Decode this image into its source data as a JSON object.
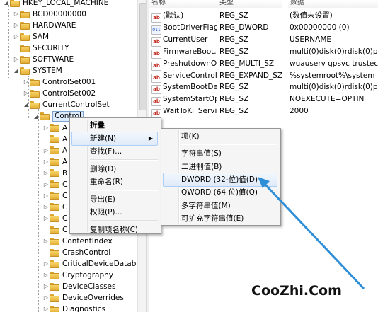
{
  "tree": {
    "items": [
      {
        "label": "HKEY_LOCAL_MACHINE",
        "exp": "◢"
      },
      {
        "label": "BCD00000000",
        "exp": "▷"
      },
      {
        "label": "HARDWARE",
        "exp": "▷"
      },
      {
        "label": "SAM",
        "exp": "▷"
      },
      {
        "label": "SECURITY",
        "exp": ""
      },
      {
        "label": "SOFTWARE",
        "exp": "▷"
      },
      {
        "label": "SYSTEM",
        "exp": "◢"
      },
      {
        "label": "ControlSet001",
        "exp": "▷"
      },
      {
        "label": "ControlSet002",
        "exp": "▷"
      },
      {
        "label": "CurrentControlSet",
        "exp": "◢"
      },
      {
        "label": "Control",
        "exp": "◢"
      },
      {
        "label": "A",
        "exp": "▷"
      },
      {
        "label": "A",
        "exp": ""
      },
      {
        "label": "A",
        "exp": "▷"
      },
      {
        "label": "A",
        "exp": "▷"
      },
      {
        "label": "B",
        "exp": "▷"
      },
      {
        "label": "C",
        "exp": "▷"
      },
      {
        "label": "C",
        "exp": "▷"
      },
      {
        "label": "C",
        "exp": "▷"
      },
      {
        "label": "C",
        "exp": "▷"
      },
      {
        "label": "C",
        "exp": ""
      },
      {
        "label": "ContentIndex",
        "exp": "▷"
      },
      {
        "label": "CrashControl",
        "exp": ""
      },
      {
        "label": "CriticalDeviceDatabas",
        "exp": "▷"
      },
      {
        "label": "Cryptography",
        "exp": "▷"
      },
      {
        "label": "DeviceClasses",
        "exp": "▷"
      },
      {
        "label": "DeviceOverrides",
        "exp": "▷"
      },
      {
        "label": "Diagnostics",
        "exp": "▷"
      }
    ]
  },
  "columns": {
    "name": "名称",
    "type": "类型",
    "data": "数据"
  },
  "values": [
    {
      "icon": "ab",
      "icon_kind": "string-value-icon",
      "name": "(默认)",
      "type": "REG_SZ",
      "data": "(数值未设置)"
    },
    {
      "icon": "011",
      "icon_kind": "binary-value-icon",
      "name": "BootDriverFlags",
      "type": "REG_DWORD",
      "data": "0x00000000 (0)"
    },
    {
      "icon": "ab",
      "icon_kind": "string-value-icon",
      "name": "CurrentUser",
      "type": "REG_SZ",
      "data": "USERNAME"
    },
    {
      "icon": "ab",
      "icon_kind": "string-value-icon",
      "name": "FirmwareBoot...",
      "type": "REG_SZ",
      "data": "multi(0)disk(0)rdisk(0)p"
    },
    {
      "icon": "ab",
      "icon_kind": "string-value-icon",
      "name": "PreshutdownO...",
      "type": "REG_MULTI_SZ",
      "data": "wuauserv gpsvc trustec"
    },
    {
      "icon": "ab",
      "icon_kind": "string-value-icon",
      "name": "ServiceControl...",
      "type": "REG_EXPAND_SZ",
      "data": "%systemroot%\\system"
    },
    {
      "icon": "ab",
      "icon_kind": "string-value-icon",
      "name": "SystemBootDe...",
      "type": "REG_SZ",
      "data": "multi(0)disk(0)rdisk(0)p"
    },
    {
      "icon": "ab",
      "icon_kind": "string-value-icon",
      "name": "SystemStartOp...",
      "type": "REG_SZ",
      "data": " NOEXECUTE=OPTIN"
    },
    {
      "icon": "ab",
      "icon_kind": "string-value-icon",
      "name": "WaitToKillServi...",
      "type": "REG_SZ",
      "data": "2000"
    }
  ],
  "context_menu": {
    "items": [
      {
        "label": "折叠",
        "bold": true
      },
      {
        "label": "新建(N)",
        "arrow": "▶",
        "highlight": true
      },
      {
        "label": "查找(F)..."
      },
      {
        "sep": true
      },
      {
        "label": "删除(D)"
      },
      {
        "label": "重命名(R)"
      },
      {
        "sep": true
      },
      {
        "label": "导出(E)"
      },
      {
        "label": "权限(P)..."
      },
      {
        "sep": true
      },
      {
        "label": "复制项名称(C)"
      }
    ]
  },
  "submenu": {
    "items": [
      {
        "label": "项(K)"
      },
      {
        "sep": true
      },
      {
        "label": "字符串值(S)"
      },
      {
        "label": "二进制值(B)"
      },
      {
        "label": "DWORD (32-位)值(D)",
        "highlight": true
      },
      {
        "label": "QWORD (64 位)值(Q)"
      },
      {
        "label": "多字符串值(M)"
      },
      {
        "label": "可扩充字符串值(E)"
      }
    ]
  },
  "annotation": {
    "arrow_color": "#2f8ed8"
  },
  "watermark": "CooZhi.Com"
}
